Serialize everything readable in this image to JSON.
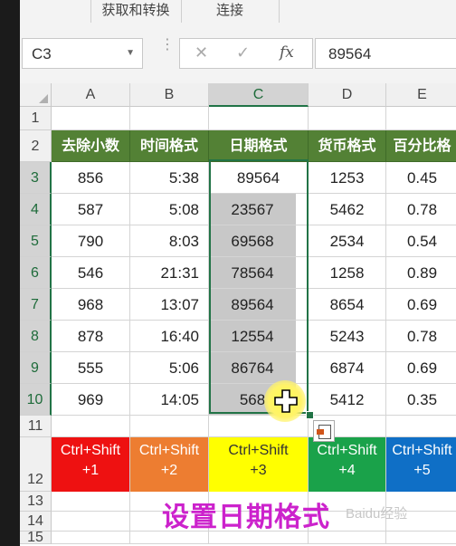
{
  "ribbon": {
    "groups": [
      "获取和转换",
      "连接"
    ]
  },
  "formula_bar": {
    "name_box": "C3",
    "cancel_symbol": "✕",
    "enter_symbol": "✓",
    "fx_label": "fx",
    "value": "89564"
  },
  "columns": [
    "A",
    "B",
    "C",
    "D",
    "E"
  ],
  "rows": [
    "1",
    "2",
    "3",
    "4",
    "5",
    "6",
    "7",
    "8",
    "9",
    "10",
    "11",
    "12",
    "13",
    "14",
    "15"
  ],
  "headers": [
    "去除小数",
    "时间格式",
    "日期格式",
    "货币格式",
    "百分比格"
  ],
  "data": [
    [
      "856",
      "5:38",
      "89564",
      "1253",
      "0.45"
    ],
    [
      "587",
      "5:08",
      "23567",
      "5462",
      "0.78"
    ],
    [
      "790",
      "8:03",
      "69568",
      "2534",
      "0.54"
    ],
    [
      "546",
      "21:31",
      "78564",
      "1258",
      "0.89"
    ],
    [
      "968",
      "13:07",
      "89564",
      "8654",
      "0.69"
    ],
    [
      "878",
      "16:40",
      "12554",
      "5243",
      "0.78"
    ],
    [
      "555",
      "5:06",
      "86764",
      "6874",
      "0.69"
    ],
    [
      "969",
      "14:05",
      "568",
      "5412",
      "0.35"
    ]
  ],
  "shortcuts": [
    {
      "line1": "Ctrl+Shift",
      "line2": "+1",
      "color": "#ee1111"
    },
    {
      "line1": "Ctrl+Shift",
      "line2": "+2",
      "color": "#ed7d31"
    },
    {
      "line1": "Ctrl+Shift",
      "line2": "+3",
      "color": "#ffff00"
    },
    {
      "line1": "Ctrl+Shift",
      "line2": "+4",
      "color": "#1aa24a"
    },
    {
      "line1": "Ctrl+Shift",
      "line2": "+5",
      "color": "#0f6fc6"
    }
  ],
  "overlay_caption": "设置日期格式",
  "watermark": "Baidu经验",
  "colors": {
    "header_green": "#538135",
    "selection_green": "#217346",
    "caption_magenta": "#cc22cc"
  }
}
